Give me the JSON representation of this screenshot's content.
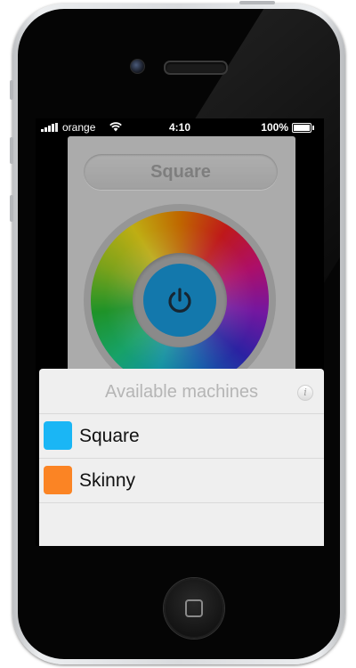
{
  "status_bar": {
    "carrier": "orange",
    "time": "4:10",
    "battery_percent": "100%",
    "battery_level": 1.0
  },
  "app": {
    "device_title": "Square",
    "power_icon": "power-icon"
  },
  "machines_sheet": {
    "title": "Available machines",
    "info_icon": "info-icon",
    "items": [
      {
        "label": "Square",
        "color": "#1ab6f5"
      },
      {
        "label": "Skinny",
        "color": "#fb8424"
      }
    ]
  }
}
